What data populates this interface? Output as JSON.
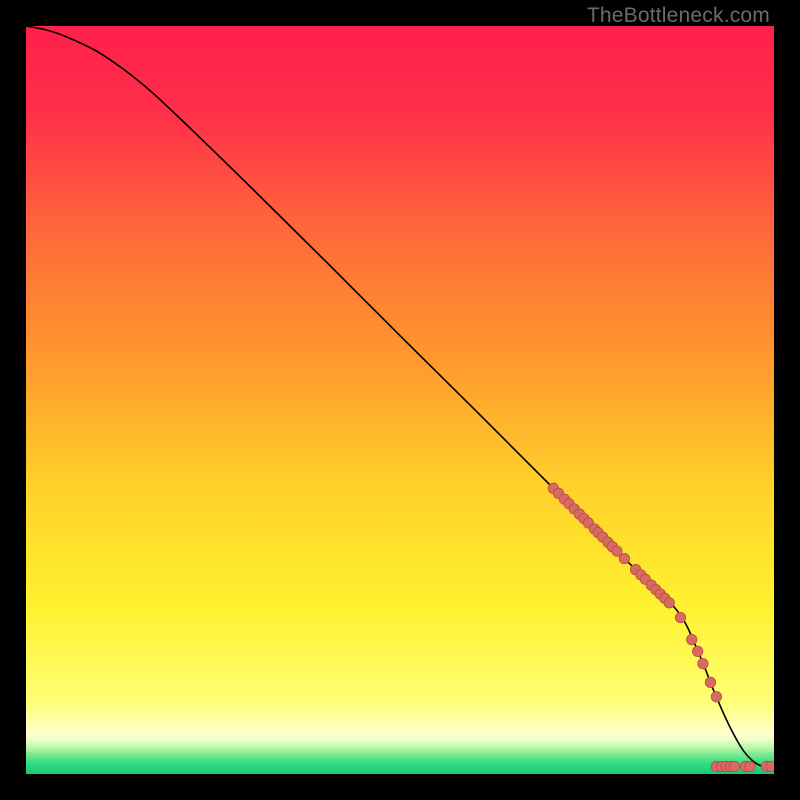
{
  "watermark": "TheBottleneck.com",
  "colors": {
    "marker_fill": "#d86a62",
    "marker_stroke": "#b54d46",
    "curve": "#000000"
  },
  "chart_data": {
    "type": "line",
    "title": "",
    "xlabel": "",
    "ylabel": "",
    "xlim": [
      0,
      100
    ],
    "ylim": [
      0,
      100
    ],
    "curve": {
      "x": [
        0,
        3,
        6,
        10,
        15,
        20,
        30,
        40,
        50,
        60,
        70,
        80,
        87,
        90,
        92,
        94,
        96,
        98,
        100
      ],
      "y": [
        100,
        99.4,
        98.3,
        96.3,
        92.7,
        88.2,
        78.5,
        68.6,
        58.6,
        48.7,
        38.7,
        28.8,
        21.9,
        16.0,
        11.0,
        6.5,
        3.0,
        1.2,
        1.0
      ]
    },
    "dots_on_curve_x": [
      70.5,
      71.2,
      72.0,
      72.6,
      73.3,
      74.0,
      74.6,
      75.2,
      76.0,
      76.5,
      77.1,
      77.8,
      78.4,
      79.0,
      80.0,
      81.5,
      82.2,
      82.8,
      83.6,
      84.2,
      84.8,
      85.4,
      86.0,
      87.5,
      89.0,
      89.8,
      90.5,
      91.5,
      92.3
    ],
    "bottom_dots": {
      "y": 1.0,
      "x": [
        92.3,
        93.0,
        93.6,
        94.2,
        94.7,
        96.2,
        96.8,
        99.0,
        99.6
      ]
    }
  }
}
